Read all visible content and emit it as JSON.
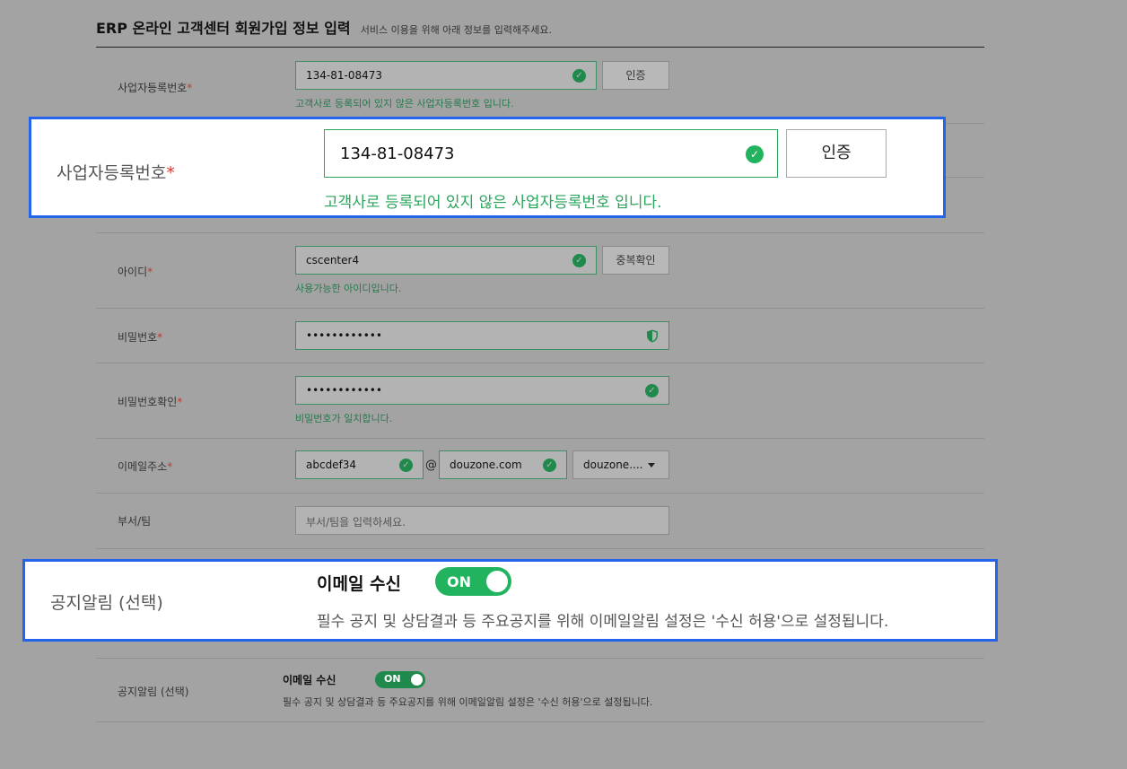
{
  "header": {
    "title": "ERP 온라인 고객센터 회원가입 정보 입력",
    "subtitle": "서비스 이용을 위해 아래 정보를 입력해주세요."
  },
  "required_mark": "*",
  "business_number": {
    "label": "사업자등록번호",
    "value": "134-81-08473",
    "button": "인증",
    "message": "고객사로 등록되어 있지 않은 사업자등록번호 입니다."
  },
  "user_id": {
    "label": "아이디",
    "value": "cscenter4",
    "button": "중복확인",
    "message": "사용가능한 아이디입니다."
  },
  "password": {
    "label": "비밀번호",
    "value": "••••••••••••"
  },
  "password_confirm": {
    "label": "비밀번호확인",
    "value": "••••••••••••",
    "message": "비밀번호가 일치합니다."
  },
  "email": {
    "label": "이메일주소",
    "local": "abcdef34",
    "at": "@",
    "domain": "douzone.com",
    "domain_select": "douzone...."
  },
  "department": {
    "label": "부서/팀",
    "placeholder": "부서/팀을 입력하세요."
  },
  "notice": {
    "label": "공지알림 (선택)",
    "email_receive": "이메일 수신",
    "toggle": "ON",
    "toggle_on": true,
    "description": "필수 공지 및 상담결과 등 주요공지를 위해 이메일알림 설정은 '수신 허용'으로 설정됩니다."
  },
  "icons": {
    "valid": "check-circle-icon",
    "password_strength": "shield-icon",
    "dropdown": "caret-down-icon"
  },
  "colors": {
    "accent_green": "#22b35f",
    "callout_border": "#2563eb",
    "required": "#c0392b"
  }
}
